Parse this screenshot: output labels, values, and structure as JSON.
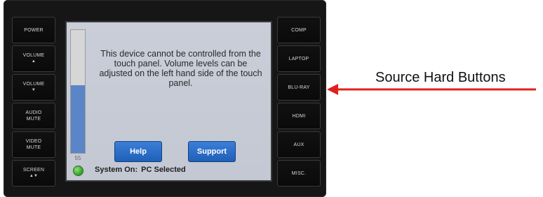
{
  "left_buttons": [
    {
      "label": "POWER",
      "glyph": ""
    },
    {
      "label": "VOLUME",
      "glyph": "▲"
    },
    {
      "label": "VOLUME",
      "glyph": "▼"
    },
    {
      "label": "AUDIO MUTE",
      "glyph": ""
    },
    {
      "label": "VIDEO MUTE",
      "glyph": ""
    },
    {
      "label": "SCREEN",
      "glyph": "▲▼"
    }
  ],
  "right_buttons": [
    {
      "label": "COMP"
    },
    {
      "label": "LAPTOP"
    },
    {
      "label": "BLU-RAY"
    },
    {
      "label": "HDMI"
    },
    {
      "label": "AUX"
    },
    {
      "label": "MISC."
    }
  ],
  "screen": {
    "message": "This device cannot be controlled from the touch panel.  Volume levels can be adjusted on the left hand side of the touch panel.",
    "volume_level_percent": 55,
    "volume_readout": "55",
    "help_label": "Help",
    "support_label": "Support",
    "status_label": "System On:",
    "status_value": "PC Selected"
  },
  "callout": {
    "text": "Source Hard Buttons",
    "arrow_color": "#e0201f"
  },
  "colors": {
    "button_blue": "#2a6fcc",
    "volume_fill": "#5a86c8",
    "status_green": "#3aa52b"
  }
}
